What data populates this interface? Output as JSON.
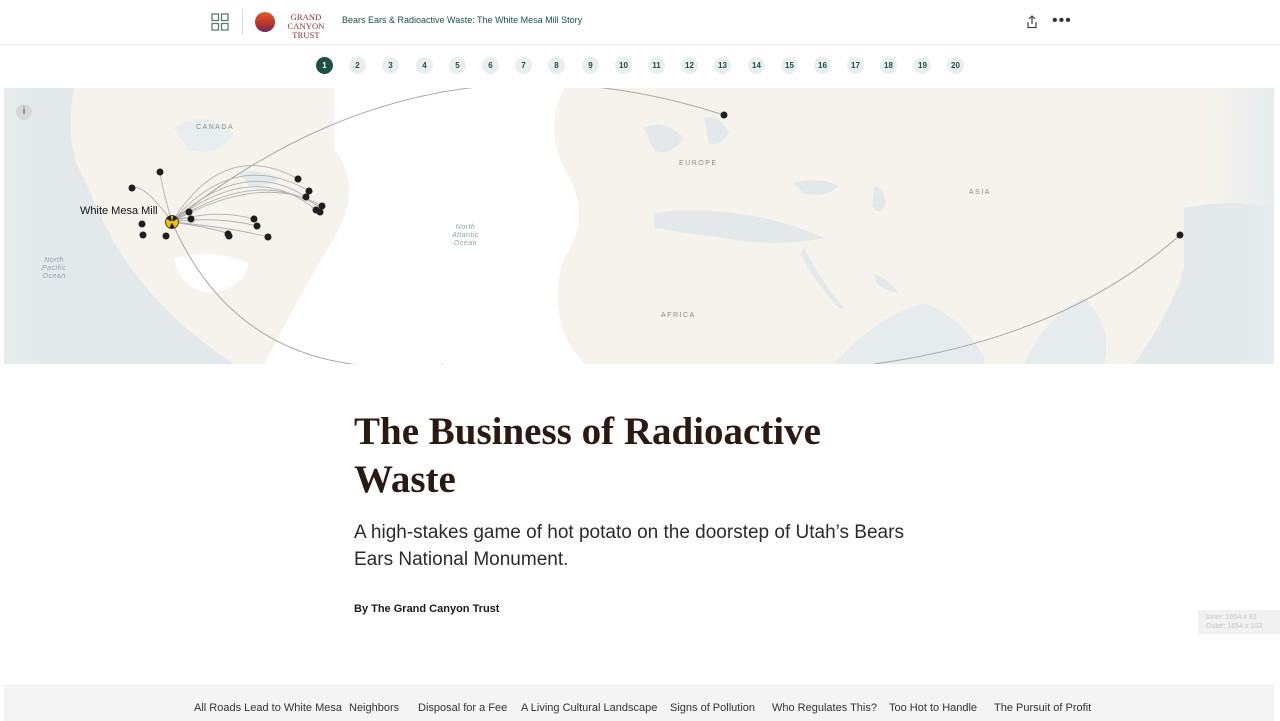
{
  "header": {
    "logo": {
      "line1": "GRAND CANYON",
      "line2": "TRUST"
    },
    "story_title": "Bears Ears & Radioactive Waste: The White Mesa Mill Story"
  },
  "pager": {
    "pages": [
      "1",
      "2",
      "3",
      "4",
      "5",
      "6",
      "7",
      "8",
      "9",
      "10",
      "11",
      "12",
      "13",
      "14",
      "15",
      "16",
      "17",
      "18",
      "19",
      "20"
    ],
    "active": "1"
  },
  "map": {
    "info_label": "i",
    "mill_label": "White Mesa Mill",
    "region_labels": [
      "CANADA",
      "EUROPE",
      "ASIA",
      "AFRICA"
    ],
    "ocean_labels": [
      {
        "lines": [
          "North",
          "Atlantic",
          "Ocean"
        ]
      },
      {
        "lines": [
          "North",
          "Pacific",
          "Ocean"
        ]
      }
    ]
  },
  "article": {
    "title_line1": "The Business of Radioactive",
    "title_line2": "Waste",
    "subtitle": "A high-stakes game of hot potato on the doorstep of Utah’s Bears Ears National Monument.",
    "byline": "By The Grand Canyon Trust"
  },
  "dimension_readout": {
    "inner": "Inner: 1654 x 92",
    "outer": "Outer: 1654 x 103"
  },
  "bottom_nav": {
    "items": [
      "All Roads Lead to White Mesa",
      "Neighbors",
      "Disposal for a Fee",
      "A Living Cultural Landscape",
      "Signs of Pollution",
      "Who Regulates This?",
      "Too Hot to Handle",
      "The Pursuit of Profit"
    ]
  },
  "colors": {
    "accent": "#1d4f47",
    "land": "#f5f3ec",
    "water": "#dfe6e8",
    "headline": "#2a1a12"
  }
}
